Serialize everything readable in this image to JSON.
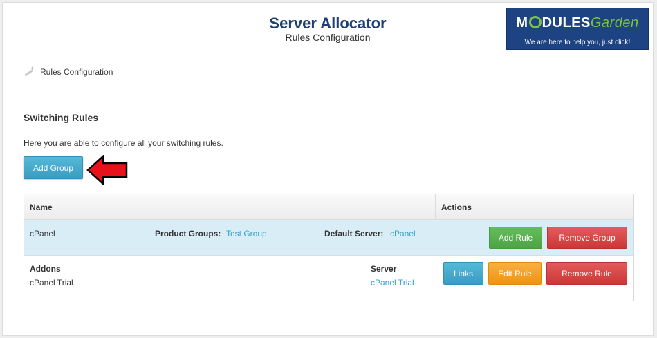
{
  "header": {
    "title": "Server Allocator",
    "subtitle": "Rules Configuration"
  },
  "logo": {
    "name_part1": "M",
    "name_part2": "DULES",
    "name_part3": "Garden",
    "tagline": "We are here to help you, just click!"
  },
  "nav": {
    "items": [
      {
        "label": "Rules Configuration",
        "icon": "wand-icon"
      }
    ]
  },
  "section": {
    "title": "Switching Rules",
    "description": "Here you are able to configure all your switching rules.",
    "add_group_label": "Add Group"
  },
  "table": {
    "headers": {
      "name": "Name",
      "actions": "Actions"
    },
    "group": {
      "name": "cPanel",
      "product_groups_label": "Product Groups:",
      "product_groups_value": "Test Group",
      "default_server_label": "Default Server:",
      "default_server_value": "cPanel",
      "add_rule_label": "Add Rule",
      "remove_group_label": "Remove Group"
    },
    "rule": {
      "addons_label": "Addons",
      "addons_value": "cPanel Trial",
      "server_label": "Server",
      "server_value": "cPanel Trial",
      "links_label": "Links",
      "edit_rule_label": "Edit Rule",
      "remove_rule_label": "Remove Rule"
    }
  },
  "colors": {
    "title": "#1e3f73",
    "logo_bg": "#1d4383",
    "logo_accent": "#7ec242",
    "info": "#3a9cc0",
    "success": "#4ea345",
    "danger": "#cc3737",
    "warning": "#ee9412",
    "group_row": "#d9edf7",
    "link": "#3aa0cf",
    "arrow": "#e8121a"
  }
}
